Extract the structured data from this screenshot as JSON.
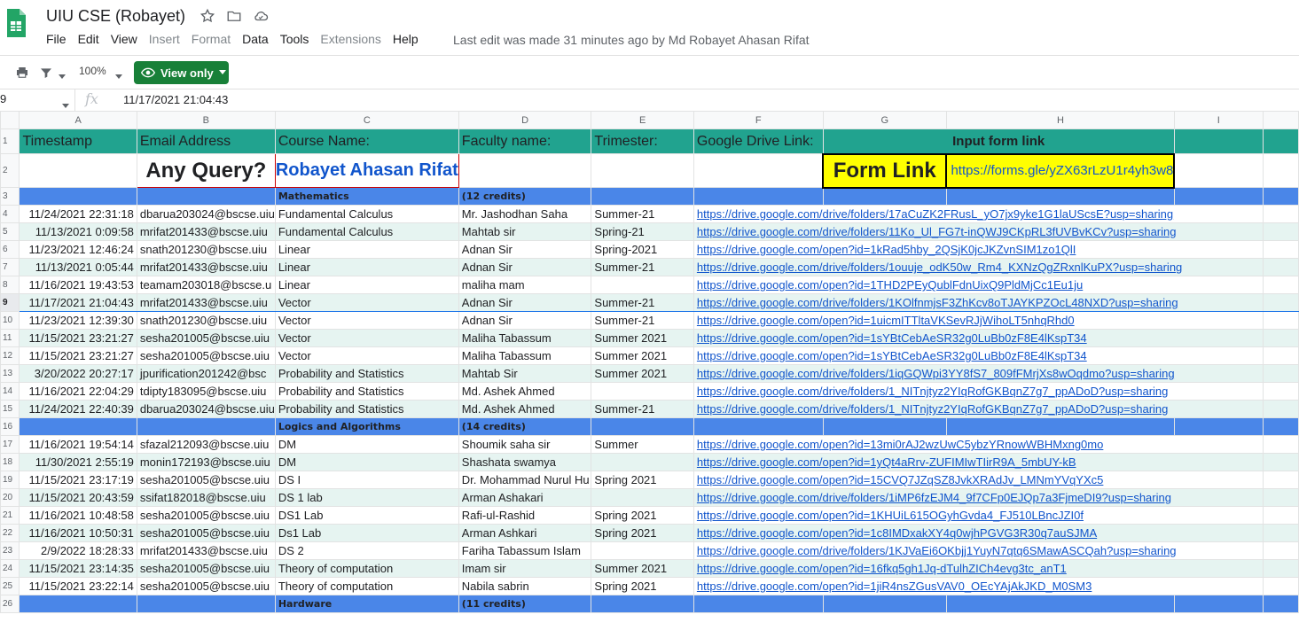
{
  "doc": {
    "title": "UIU CSE (Robayet)",
    "last_edit": "Last edit was made 31 minutes ago by Md Robayet Ahasan Rifat"
  },
  "menu": [
    {
      "label": "File",
      "disabled": false
    },
    {
      "label": "Edit",
      "disabled": false
    },
    {
      "label": "View",
      "disabled": false
    },
    {
      "label": "Insert",
      "disabled": true
    },
    {
      "label": "Format",
      "disabled": true
    },
    {
      "label": "Data",
      "disabled": false
    },
    {
      "label": "Tools",
      "disabled": false
    },
    {
      "label": "Extensions",
      "disabled": true
    },
    {
      "label": "Help",
      "disabled": false
    }
  ],
  "toolbar": {
    "zoom": "100%",
    "view_only": "View only"
  },
  "formula_bar": {
    "name_box": "9",
    "fx": "fx",
    "value": "11/17/2021 21:04:43"
  },
  "columns": [
    "A",
    "B",
    "C",
    "D",
    "E",
    "F",
    "G",
    "H",
    "I"
  ],
  "header_row": {
    "a": "Timestamp",
    "b": "Email Address",
    "c": "Course Name:",
    "d": "Faculty name:",
    "e": "Trimester:",
    "f": "Google Drive Link:",
    "gh": "Input form link"
  },
  "row2": {
    "any_query": "Any Query?",
    "author": "Robayet Ahasan Rifat",
    "form_link": "Form Link",
    "form_url": "https://forms.gle/yZX63rLzU1r4yh3w8"
  },
  "rows": [
    {
      "kind": "section",
      "c": "Mathematics",
      "d": "(12 credits)"
    },
    {
      "ts": "11/24/2021 22:31:18",
      "email": "dbarua203024@bscse.uiu",
      "course": "Fundamental Calculus",
      "faculty": "Mr. Jashodhan Saha",
      "tri": "Summer-21",
      "link": "https://drive.google.com/drive/folders/17aCuZK2FRusL_yO7jx9yke1G1laUScsE?usp=sharing"
    },
    {
      "ts": "11/13/2021 0:09:58",
      "email": "mrifat201433@bscse.uiu",
      "course": "Fundamental Calculus",
      "faculty": "Mahtab sir",
      "tri": "Spring-21",
      "link": "https://drive.google.com/drive/folders/11Ko_Ul_FG7t-inQWJ9CKpRL3fUVBvKCv?usp=sharing"
    },
    {
      "ts": "11/23/2021 12:46:24",
      "email": "snath201230@bscse.uiu",
      "course": "Linear",
      "faculty": "Adnan Sir",
      "tri": "Spring-2021",
      "link": "https://drive.google.com/open?id=1kRad5hby_2QSjK0jcJKZvnSIM1zo1QlI"
    },
    {
      "ts": "11/13/2021 0:05:44",
      "email": "mrifat201433@bscse.uiu",
      "course": "Linear",
      "faculty": "Adnan Sir",
      "tri": "Summer-21",
      "link": "https://drive.google.com/drive/folders/1ouuje_odK50w_Rm4_KXNzQgZRxnlKuPX?usp=sharing"
    },
    {
      "ts": "11/16/2021 19:43:53",
      "email": "teamam203018@bscse.u",
      "course": "Linear",
      "faculty": "maliha mam",
      "tri": "",
      "link": "https://drive.google.com/open?id=1THD2PEyQublFdnUixQ9PldMjCc1Eu1ju"
    },
    {
      "ts": "11/17/2021 21:04:43",
      "email": "mrifat201433@bscse.uiu",
      "course": "Vector",
      "faculty": "Adnan Sir",
      "tri": "Summer-21",
      "link": "https://drive.google.com/drive/folders/1KOlfnmjsF3ZhKcv8oTJAYKPZOcL48NXD?usp=sharing",
      "selected": true
    },
    {
      "ts": "11/23/2021 12:39:30",
      "email": "snath201230@bscse.uiu",
      "course": "Vector",
      "faculty": "Adnan Sir",
      "tri": "Summer-21",
      "link": "https://drive.google.com/open?id=1uicmITTltaVKSevRJjWihoLT5nhqRhd0"
    },
    {
      "ts": "11/15/2021 23:21:27",
      "email": "sesha201005@bscse.uiu",
      "course": "Vector",
      "faculty": "Maliha Tabassum",
      "tri": "Summer 2021",
      "link": "https://drive.google.com/open?id=1sYBtCebAeSR32g0LuBb0zF8E4lKspT34"
    },
    {
      "ts": "11/15/2021 23:21:27",
      "email": "sesha201005@bscse.uiu",
      "course": "Vector",
      "faculty": "Maliha Tabassum",
      "tri": "Summer 2021",
      "link": "https://drive.google.com/open?id=1sYBtCebAeSR32g0LuBb0zF8E4lKspT34"
    },
    {
      "ts": "3/20/2022 20:27:17",
      "email": "jpurification201242@bsc",
      "course": " Probability and Statistics",
      "faculty": "Mahtab Sir",
      "tri": "Summer 2021",
      "link": "https://drive.google.com/drive/folders/1iqGQWpi3YY8fS7_809fFMrjXs8wOqdmo?usp=sharing"
    },
    {
      "ts": "11/16/2021 22:04:29",
      "email": "tdipty183095@bscse.uiu",
      "course": " Probability and Statistics",
      "faculty": "Md. Ashek Ahmed",
      "tri": "",
      "link": "https://drive.google.com/drive/folders/1_NITnjtyz2YIqRofGKBqnZ7g7_ppADoD?usp=sharing"
    },
    {
      "ts": "11/24/2021 22:40:39",
      "email": "dbarua203024@bscse.uiu",
      "course": " Probability and Statistics",
      "faculty": "Md. Ashek Ahmed",
      "tri": "Summer-21",
      "link": "https://drive.google.com/drive/folders/1_NITnjtyz2YIqRofGKBqnZ7g7_ppADoD?usp=sharing"
    },
    {
      "kind": "section",
      "c": "Logics and Algorithms",
      "d": "(14 credits)"
    },
    {
      "ts": "11/16/2021 19:54:14",
      "email": "sfazal212093@bscse.uiu",
      "course": "DM",
      "faculty": "Shoumik saha sir",
      "tri": "Summer",
      "link": "https://drive.google.com/open?id=13mi0rAJ2wzUwC5ybzYRnowWBHMxng0mo"
    },
    {
      "ts": "11/30/2021 2:55:19",
      "email": "monin172193@bscse.uiu",
      "course": "DM",
      "faculty": "Shashata swamya",
      "tri": "",
      "link": "https://drive.google.com/open?id=1yQt4aRrv-ZUFIMIwTIirR9A_5mbUY-kB"
    },
    {
      "ts": "11/15/2021 23:17:19",
      "email": "sesha201005@bscse.uiu",
      "course": "DS I",
      "faculty": "Dr. Mohammad Nurul Hu",
      "tri": "Spring 2021",
      "link": "https://drive.google.com/open?id=15CVQ7JZqSZ8JvkXRAdJv_LMNmYVqYXc5"
    },
    {
      "ts": "11/15/2021 20:43:59",
      "email": "ssifat182018@bscse.uiu",
      "course": "DS 1 lab",
      "faculty": "Arman Ashakari",
      "tri": "",
      "link": "https://drive.google.com/drive/folders/1iMP6fzEJM4_9f7CFp0EJQp7a3FjmeDI9?usp=sharing"
    },
    {
      "ts": "11/16/2021 10:48:58",
      "email": "sesha201005@bscse.uiu",
      "course": "DS1 Lab",
      "faculty": "Rafi-ul-Rashid",
      "tri": "Spring 2021",
      "link": "https://drive.google.com/open?id=1KHUiL615OGyhGvda4_FJ510LBncJZI0f"
    },
    {
      "ts": "11/16/2021 10:50:31",
      "email": "sesha201005@bscse.uiu",
      "course": "Ds1 Lab",
      "faculty": "Arman Ashkari",
      "tri": "Spring 2021",
      "link": "https://drive.google.com/open?id=1c8IMDxakXY4q0wjhPGVG3R30q7auSJMA"
    },
    {
      "ts": "2/9/2022 18:28:33",
      "email": "mrifat201433@bscse.uiu",
      "course": "DS 2",
      "faculty": "Fariha Tabassum Islam",
      "tri": "",
      "link": "https://drive.google.com/drive/folders/1KJVaEi6OKbjj1YuyN7qtq6SMawASCQah?usp=sharing"
    },
    {
      "ts": "11/15/2021 23:14:35",
      "email": "sesha201005@bscse.uiu",
      "course": "Theory of computation",
      "faculty": "Imam sir",
      "tri": "Summer 2021",
      "link": "https://drive.google.com/open?id=16fkq5gh1Jq-dTulhZICh4evg3tc_anT1"
    },
    {
      "ts": "11/15/2021 23:22:14",
      "email": "sesha201005@bscse.uiu",
      "course": "Theory of computation",
      "faculty": "Nabila sabrin",
      "tri": "Spring 2021",
      "link": "https://drive.google.com/open?id=1jiR4nsZGusVAV0_OEcYAjAkJKD_M0SM3"
    },
    {
      "kind": "section",
      "c": "Hardware",
      "d": "(11 credits)"
    }
  ]
}
